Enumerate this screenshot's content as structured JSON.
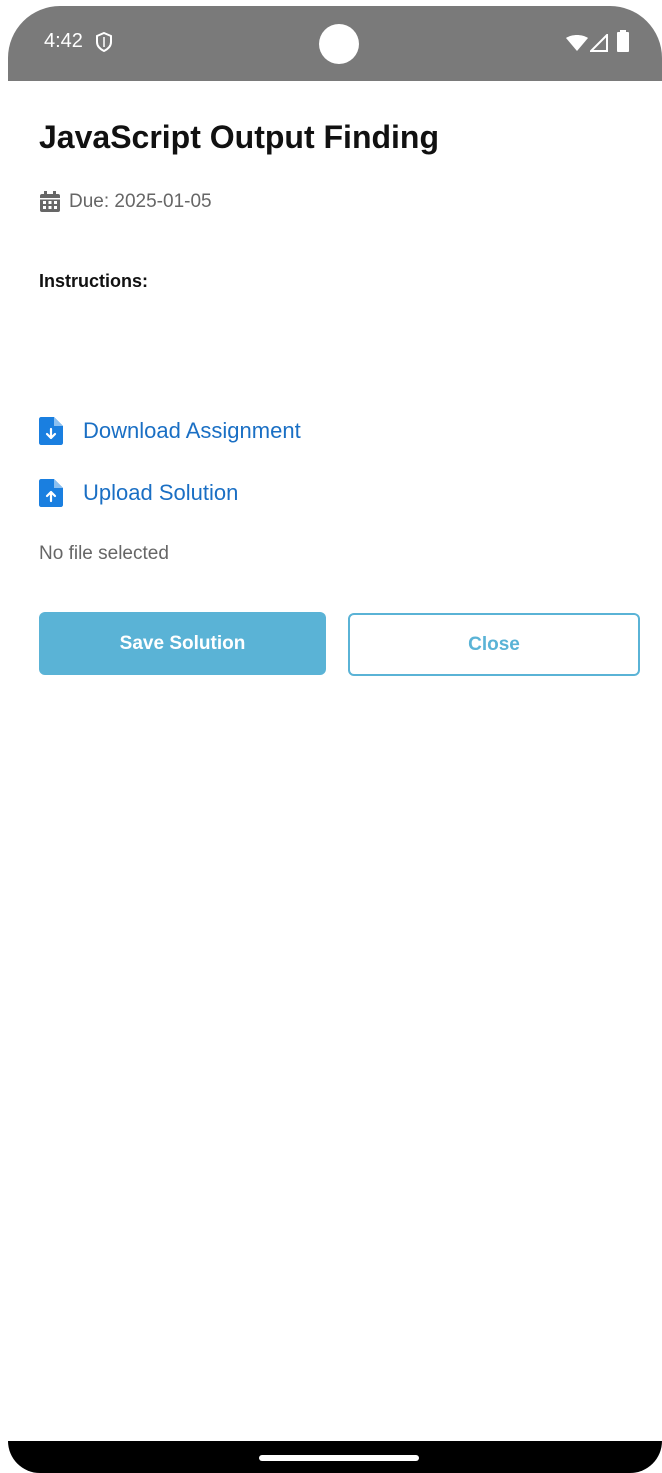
{
  "status_bar": {
    "time": "4:42",
    "icons": [
      "shield-icon",
      "wifi-icon",
      "signal-icon",
      "battery-icon"
    ]
  },
  "assignment": {
    "title": "JavaScript Output Finding",
    "due": "Due: 2025-01-05",
    "instructions_label": "Instructions:",
    "download_label": "Download Assignment",
    "upload_label": "Upload Solution",
    "file_status": "No file selected"
  },
  "buttons": {
    "save_label": "Save Solution",
    "close_label": "Close"
  },
  "colors": {
    "link": "#1a6fc4",
    "accent": "#5ab3d6",
    "status_bar": "#7a7a7a"
  }
}
